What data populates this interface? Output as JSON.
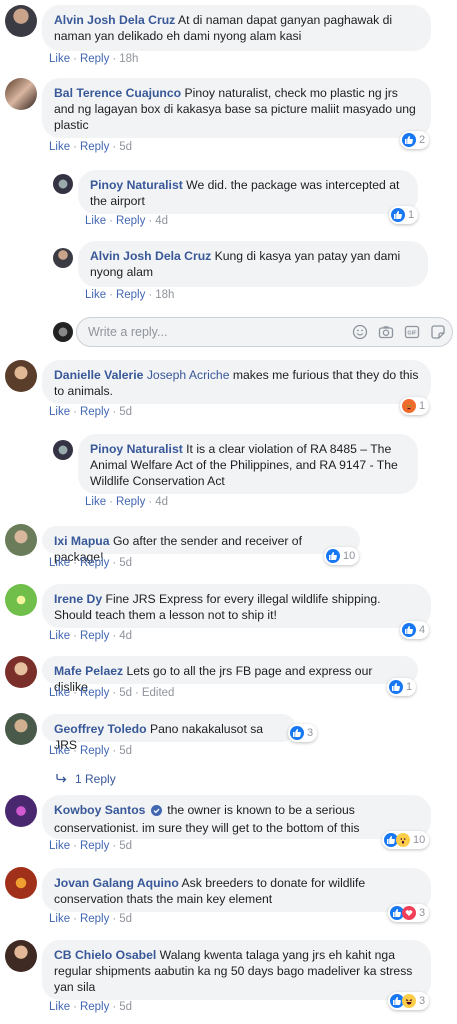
{
  "comments": [
    {
      "author": "Alvin Josh Dela Cruz",
      "text": "At di naman dapat ganyan paghawak di naman yan delikado eh dami nyong alam kasi",
      "like": "Like",
      "reply": "Reply",
      "time": "18h"
    },
    {
      "author": "Bal Terence Cuajunco",
      "text": "Pinoy naturalist, check mo plastic ng jrs and ng lagayan box di kakasya base sa picture maliit masyado ung plastic",
      "like": "Like",
      "reply": "Reply",
      "time": "5d",
      "reactions": "2"
    },
    {
      "author": "Pinoy Naturalist",
      "text": "We did. the package was intercepted at the airport",
      "like": "Like",
      "reply": "Reply",
      "time": "4d",
      "reactions": "1"
    },
    {
      "author": "Alvin Josh Dela Cruz",
      "text": "Kung di kasya yan patay yan dami nyong alam",
      "like": "Like",
      "reply": "Reply",
      "time": "18h"
    },
    {
      "author": "Danielle Valerie",
      "tag": "Joseph Acriche",
      "text": "makes me furious that they do this to animals.",
      "like": "Like",
      "reply": "Reply",
      "time": "5d",
      "reactions": "1"
    },
    {
      "author": "Pinoy Naturalist",
      "text": "It is a clear violation of RA 8485 – The Animal Welfare Act of the Philippines, and RA 9147 - The Wildlife Conservation Act",
      "like": "Like",
      "reply": "Reply",
      "time": "4d"
    },
    {
      "author": "Ixi Mapua",
      "text": "Go after the sender and receiver of package!",
      "like": "Like",
      "reply": "Reply",
      "time": "5d",
      "reactions": "10"
    },
    {
      "author": "Irene Dy",
      "text": "Fine JRS Express for every illegal wildlife shipping. Should teach them a lesson not to ship it!",
      "like": "Like",
      "reply": "Reply",
      "time": "4d",
      "reactions": "4"
    },
    {
      "author": "Mafe Pelaez",
      "text": "Lets go to all the jrs FB page and express our dislike",
      "like": "Like",
      "reply": "Reply",
      "time": "5d",
      "edited": "Edited",
      "reactions": "1"
    },
    {
      "author": "Geoffrey Toledo",
      "text": "Pano nakakalusot sa JRS",
      "like": "Like",
      "reply": "Reply",
      "time": "5d",
      "reactions": "3"
    },
    {
      "author": "Kowboy Santos",
      "text": "the owner is known to be a serious conservationist. im sure they will get to the bottom of this",
      "like": "Like",
      "reply": "Reply",
      "time": "5d",
      "reactions": "10"
    },
    {
      "author": "Jovan Galang Aquino",
      "text": "Ask breeders to donate for wildlife conservation thats the main key element",
      "like": "Like",
      "reply": "Reply",
      "time": "5d",
      "reactions": "3"
    },
    {
      "author": "CB Chielo Osabel",
      "text": "Walang kwenta talaga yang jrs eh kahit nga regular shipments aabutin ka ng 50 days bago madeliver ka stress yan sila",
      "like": "Like",
      "reply": "Reply",
      "time": "5d",
      "reactions": "3"
    }
  ],
  "reply_box": {
    "placeholder": "Write a reply..."
  },
  "more_replies": "1 Reply",
  "colors": {
    "link": "#385898",
    "like_blue": "#1877f2",
    "love_red": "#f33e58",
    "angry": "#f06a2c",
    "wow_yellow": "#fbcd49"
  }
}
